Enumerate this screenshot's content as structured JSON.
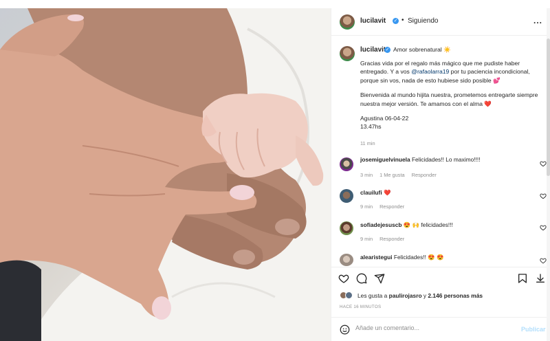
{
  "post": {
    "username": "lucilavit",
    "verified_mark": "✓",
    "separator": "•",
    "follow_status": "Siguiendo",
    "more_label": "...",
    "caption": {
      "username": "lucilavit",
      "title": "Amor sobrenatural ☀️",
      "line1": "Gracias vida por el regalo más mágico que me pudiste haber entregado. Y a vos ",
      "mention": "@rafaolarra19",
      "line1_end": " por tu paciencia incondicional, porque sin vos, nada de esto hubiese sido posible 💕",
      "line2": "Bienvenida al mundo hijita nuestra, prometemos entregarte siempre nuestra mejor versión. Te amamos con el alma ❤️",
      "line3a": "Agustina 06-04-22",
      "line3b": "13.47hs",
      "time": "11 min"
    }
  },
  "comments": [
    {
      "username": "josemiguelvinuela",
      "text": "Felicidades!! Lo maximo!!!!",
      "time": "3 min",
      "likes": "1 Me gusta",
      "reply": "Responder"
    },
    {
      "username": "clauilufi",
      "text": "❤️",
      "time": "9 min",
      "reply": "Responder"
    },
    {
      "username": "sofiadejesuscb",
      "text": "😍 🙌 felicidades!!!",
      "time": "9 min",
      "reply": "Responder"
    },
    {
      "username": "alearistegui",
      "text": "Felicidades!! 😍 😍"
    }
  ],
  "likes": {
    "prefix": "Les gusta a ",
    "user": "paulirojasro",
    "middle": " y ",
    "count": "2.146 personas más"
  },
  "posted_ago": "HACE 16 MINUTOS",
  "add_comment": {
    "placeholder": "Añade un comentario...",
    "publish": "Publicar"
  },
  "icons": {
    "heart": "heart-icon",
    "comment": "comment-icon",
    "share": "share-icon",
    "save": "bookmark-icon",
    "download": "download-icon",
    "emoji": "emoji-icon"
  },
  "colors": {
    "link": "#00376b",
    "verified": "#3897f0",
    "heart": "#ed4956",
    "publish_disabled": "#b2dffc"
  }
}
